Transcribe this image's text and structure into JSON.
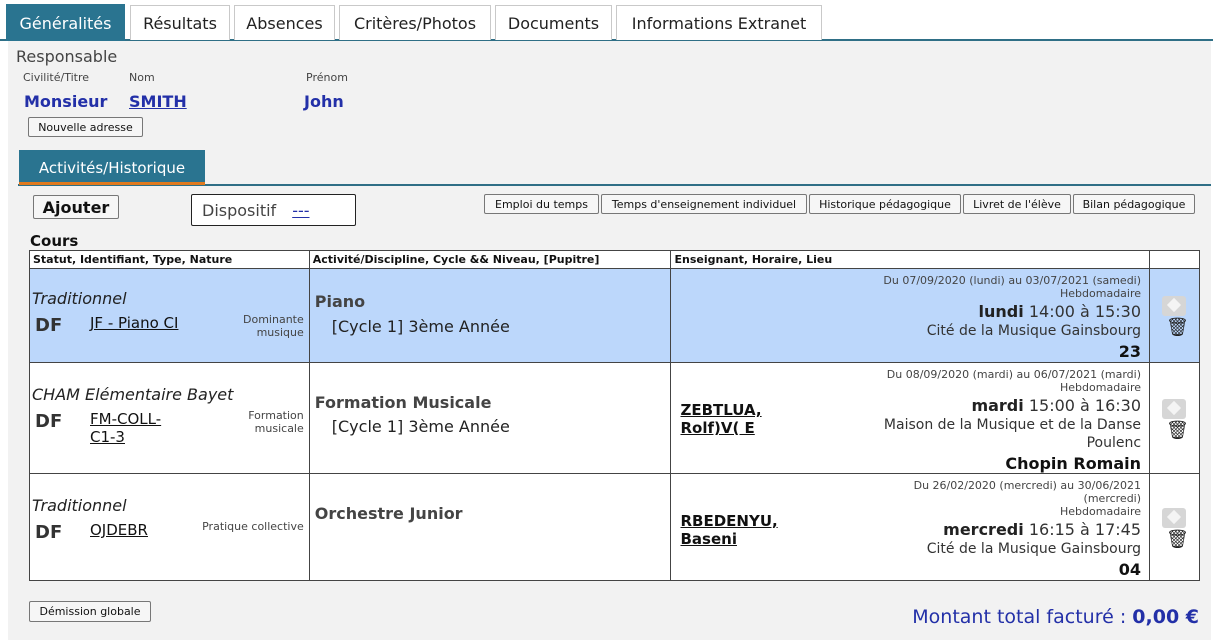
{
  "tabs": [
    {
      "label": "Généralités",
      "active": true
    },
    {
      "label": "Résultats"
    },
    {
      "label": "Absences"
    },
    {
      "label": "Critères/Photos"
    },
    {
      "label": "Documents"
    },
    {
      "label": "Informations Extranet"
    }
  ],
  "responsable": {
    "title": "Responsable",
    "civilite_label": "Civilité/Titre",
    "nom_label": "Nom",
    "prenom_label": "Prénom",
    "civilite": "Monsieur",
    "nom": "SMITH",
    "prenom": "John",
    "new_address_button": "Nouvelle adresse"
  },
  "subtab": {
    "label": "Activités/Historique"
  },
  "toolbar": {
    "ajouter": "Ajouter",
    "dispositif_label": "Dispositif",
    "dispositif_value": "---",
    "buttons": [
      "Emploi du temps",
      "Temps d'enseignement individuel",
      "Historique pédagogique",
      "Livret de l'élève",
      "Bilan pédagogique"
    ]
  },
  "cours": {
    "title": "Cours",
    "headers": [
      "Statut, Identifiant, Type, Nature",
      "Activité/Discipline, Cycle && Niveau, [Pupitre]",
      "Enseignant, Horaire, Lieu",
      ""
    ],
    "rows": [
      {
        "statut": "Traditionnel",
        "code": "DF",
        "identifiant_lines": [
          "JF - Piano CI"
        ],
        "type_lines": [
          "Dominante",
          "musique"
        ],
        "discipline": "Piano",
        "cycle": "[Cycle 1] 3ème Année",
        "enseignant_lines": [],
        "period_lines": [
          "Du 07/09/2020 (lundi) au 03/07/2021 (samedi)",
          "Hebdomadaire"
        ],
        "jour": "lundi",
        "heure": "14:00 à 15:30",
        "lieu_lines": [
          "Cité de la Musique Gainsbourg"
        ],
        "salle": "23",
        "selected": true
      },
      {
        "statut": "CHAM Elémentaire Bayet",
        "code": "DF",
        "identifiant_lines": [
          "FM-COLL-",
          "C1-3"
        ],
        "type_lines": [
          "Formation",
          "musicale"
        ],
        "discipline": "Formation Musicale",
        "cycle": "[Cycle 1] 3ème Année",
        "enseignant_lines": [
          "ZEBTLUA,",
          "Rolf)V( E"
        ],
        "period_lines": [
          "Du 08/09/2020 (mardi) au 06/07/2021 (mardi)",
          "Hebdomadaire"
        ],
        "jour": "mardi",
        "heure": "15:00 à 16:30",
        "lieu_lines": [
          "Maison de la Musique et de la Danse",
          "Poulenc"
        ],
        "salle": "Chopin Romain",
        "selected": false
      },
      {
        "statut": "Traditionnel",
        "code": "DF",
        "identifiant_lines": [
          "OJDEBR"
        ],
        "type_lines": [
          "Pratique collective"
        ],
        "discipline": "Orchestre Junior",
        "cycle": "",
        "enseignant_lines": [
          "RBEDENYU,",
          "Baseni"
        ],
        "period_lines": [
          "Du 26/02/2020 (mercredi) au 30/06/2021",
          "(mercredi)",
          "Hebdomadaire"
        ],
        "jour": "mercredi",
        "heure": "16:15 à 17:45",
        "lieu_lines": [
          "Cité de la Musique Gainsbourg"
        ],
        "salle": "04",
        "selected": false
      }
    ]
  },
  "footer": {
    "demission_button": "Démission globale",
    "total_label": "Montant total facturé : ",
    "total_value": "0,00 €"
  },
  "icons": {
    "edit": "edit-icon",
    "delete": "trash-icon"
  }
}
